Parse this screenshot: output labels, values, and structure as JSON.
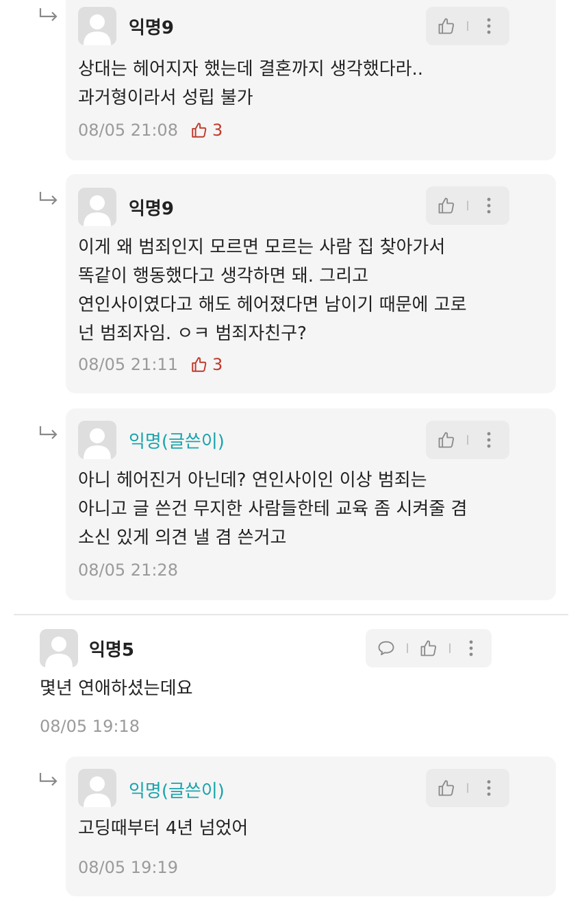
{
  "comments": [
    {
      "author": "익명9",
      "lines": [
        "상대는 헤어지자 했는데 결혼까지 생각했다라..",
        "과거형이라서 성립 불가"
      ],
      "time": "08/05 21:08",
      "likes": "3"
    },
    {
      "author": "익명9",
      "lines": [
        "이게 왜 범죄인지 모르면 모르는 사람 집 찾아가서",
        "똑같이 행동했다고 생각하면 돼. 그리고",
        "연인사이였다고 해도 헤어졌다면 남이기 때문에 고로",
        "넌 범죄자임. ㅇㅋ 범죄자친구?"
      ],
      "time": "08/05 21:11",
      "likes": "3"
    },
    {
      "author": "익명(글쓴이)",
      "lines": [
        "아니 헤어진거 아닌데? 연인사이인 이상 범죄는",
        "아니고 글 쓴건 무지한 사람들한테 교육 좀 시켜줄 겸",
        "소신 있게 의견 낼 겸 쓴거고"
      ],
      "time": "08/05 21:28"
    },
    {
      "author": "익명5",
      "lines": [
        "몇년 연애하셨는데요"
      ],
      "time": "08/05 19:18"
    },
    {
      "author": "익명(글쓴이)",
      "lines": [
        "고딩때부터 4년 넘었어"
      ],
      "time": "08/05 19:19"
    }
  ],
  "colors": {
    "op_author": "#19a3ac",
    "like_red": "#c0392b",
    "card_bg": "#f5f5f5"
  },
  "icons": [
    "reply-arrow-icon",
    "avatar-placeholder-icon",
    "thumbs-up-icon",
    "more-vertical-icon",
    "speech-bubble-icon"
  ]
}
